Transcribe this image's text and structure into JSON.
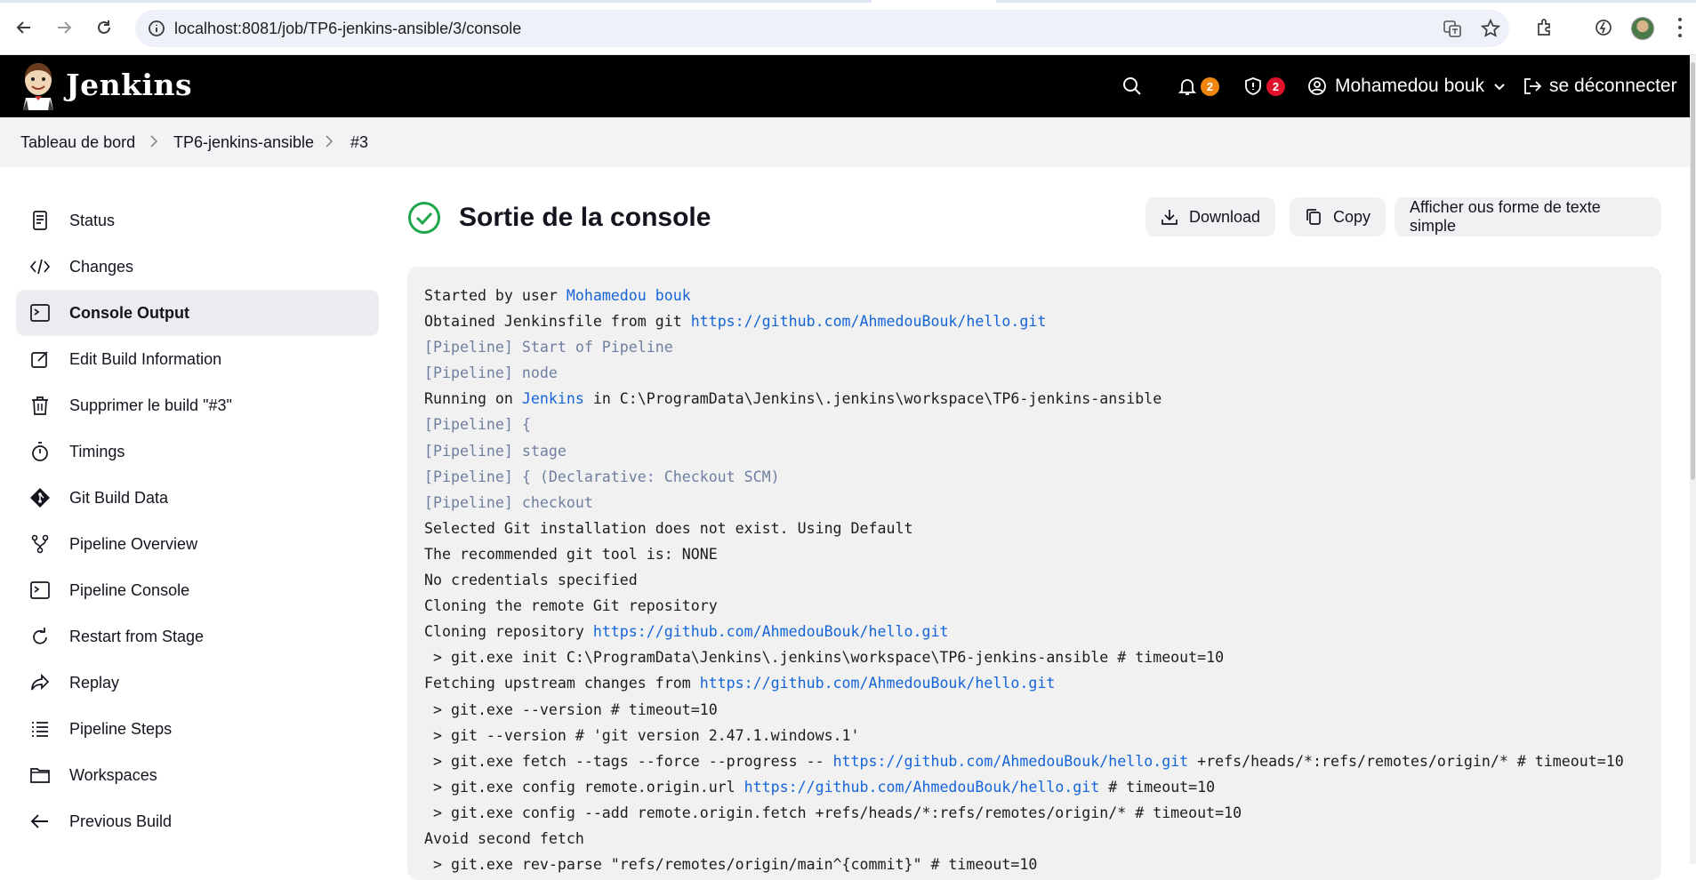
{
  "browser": {
    "url": "localhost:8081/job/TP6-jenkins-ansible/3/console"
  },
  "header": {
    "app_name": "Jenkins",
    "notifications_count": "2",
    "security_count": "2",
    "user_name": "Mohamedou bouk",
    "logout_label": "se déconnecter",
    "colors": {
      "bg": "#000000",
      "notif_badge": "#f0860f",
      "security_badge": "#e0122b"
    }
  },
  "breadcrumb": {
    "items": [
      "Tableau de bord",
      "TP6-jenkins-ansible",
      "#3"
    ]
  },
  "sidebar": {
    "items": [
      {
        "label": "Status",
        "icon": "status-icon"
      },
      {
        "label": "Changes",
        "icon": "code-icon"
      },
      {
        "label": "Console Output",
        "icon": "terminal-icon",
        "active": true
      },
      {
        "label": "Edit Build Information",
        "icon": "edit-icon"
      },
      {
        "label": "Supprimer le build \"#3\"",
        "icon": "trash-icon"
      },
      {
        "label": "Timings",
        "icon": "stopwatch-icon"
      },
      {
        "label": "Git Build Data",
        "icon": "git-icon"
      },
      {
        "label": "Pipeline Overview",
        "icon": "branch-icon"
      },
      {
        "label": "Pipeline Console",
        "icon": "terminal-icon"
      },
      {
        "label": "Restart from Stage",
        "icon": "restart-icon"
      },
      {
        "label": "Replay",
        "icon": "replay-icon"
      },
      {
        "label": "Pipeline Steps",
        "icon": "list-icon"
      },
      {
        "label": "Workspaces",
        "icon": "folder-icon"
      },
      {
        "label": "Previous Build",
        "icon": "arrow-left-icon"
      }
    ]
  },
  "main": {
    "title": "Sortie de la console",
    "status_color": "#1ea64b",
    "download_label": "Download",
    "copy_label": "Copy",
    "plain_text_label": "Afficher ous forme de texte simple"
  },
  "console": {
    "lines": [
      {
        "segments": [
          {
            "t": "Started by user "
          },
          {
            "t": "Mohamedou bouk",
            "link": true
          }
        ]
      },
      {
        "segments": [
          {
            "t": "Obtained Jenkinsfile from git "
          },
          {
            "t": "https://github.com/AhmedouBouk/hello.git",
            "link": true
          }
        ]
      },
      {
        "pipe": true,
        "segments": [
          {
            "t": "[Pipeline] Start of Pipeline"
          }
        ]
      },
      {
        "pipe": true,
        "segments": [
          {
            "t": "[Pipeline] node"
          }
        ]
      },
      {
        "segments": [
          {
            "t": "Running on "
          },
          {
            "t": "Jenkins",
            "link": true
          },
          {
            "t": " in C:\\ProgramData\\Jenkins\\.jenkins\\workspace\\TP6-jenkins-ansible"
          }
        ]
      },
      {
        "pipe": true,
        "segments": [
          {
            "t": "[Pipeline] {"
          }
        ]
      },
      {
        "pipe": true,
        "segments": [
          {
            "t": "[Pipeline] stage"
          }
        ]
      },
      {
        "pipe": true,
        "segments": [
          {
            "t": "[Pipeline] { (Declarative: Checkout SCM)"
          }
        ]
      },
      {
        "pipe": true,
        "segments": [
          {
            "t": "[Pipeline] checkout"
          }
        ]
      },
      {
        "segments": [
          {
            "t": "Selected Git installation does not exist. Using Default"
          }
        ]
      },
      {
        "segments": [
          {
            "t": "The recommended git tool is: NONE"
          }
        ]
      },
      {
        "segments": [
          {
            "t": "No credentials specified"
          }
        ]
      },
      {
        "segments": [
          {
            "t": "Cloning the remote Git repository"
          }
        ]
      },
      {
        "segments": [
          {
            "t": "Cloning repository "
          },
          {
            "t": "https://github.com/AhmedouBouk/hello.git",
            "link": true
          }
        ]
      },
      {
        "segments": [
          {
            "t": " > git.exe init C:\\ProgramData\\Jenkins\\.jenkins\\workspace\\TP6-jenkins-ansible # timeout=10"
          }
        ]
      },
      {
        "segments": [
          {
            "t": "Fetching upstream changes from "
          },
          {
            "t": "https://github.com/AhmedouBouk/hello.git",
            "link": true
          }
        ]
      },
      {
        "segments": [
          {
            "t": " > git.exe --version # timeout=10"
          }
        ]
      },
      {
        "segments": [
          {
            "t": " > git --version # 'git version 2.47.1.windows.1'"
          }
        ]
      },
      {
        "segments": [
          {
            "t": " > git.exe fetch --tags --force --progress -- "
          },
          {
            "t": "https://github.com/AhmedouBouk/hello.git",
            "link": true
          },
          {
            "t": " +refs/heads/*:refs/remotes/origin/* # timeout=10"
          }
        ]
      },
      {
        "segments": [
          {
            "t": " > git.exe config remote.origin.url "
          },
          {
            "t": "https://github.com/AhmedouBouk/hello.git",
            "link": true
          },
          {
            "t": " # timeout=10"
          }
        ]
      },
      {
        "segments": [
          {
            "t": " > git.exe config --add remote.origin.fetch +refs/heads/*:refs/remotes/origin/* # timeout=10"
          }
        ]
      },
      {
        "segments": [
          {
            "t": "Avoid second fetch"
          }
        ]
      },
      {
        "segments": [
          {
            "t": " > git.exe rev-parse \"refs/remotes/origin/main^{commit}\" # timeout=10"
          }
        ]
      }
    ]
  }
}
